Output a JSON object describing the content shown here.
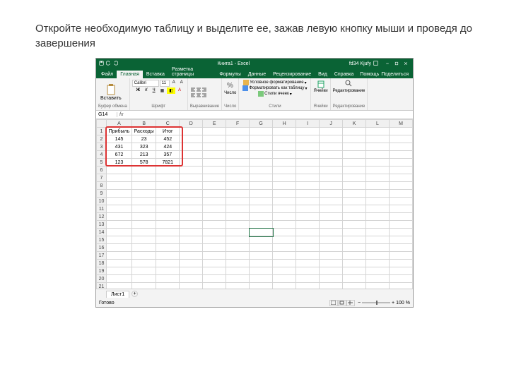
{
  "instruction": "Откройте необходимую таблицу и выделите ее, зажав левую кнопку мыши и проведя до завершения",
  "titlebar": {
    "doc": "Книга1 - Excel",
    "user": "fd34 Kjufy"
  },
  "tabs": {
    "file": "Файл",
    "items": [
      "Главная",
      "Вставка",
      "Разметка страницы",
      "Формулы",
      "Данные",
      "Рецензирование",
      "Вид",
      "Справка"
    ],
    "active": 0,
    "help": "Помощь",
    "share": "Поделиться"
  },
  "ribbon": {
    "paste": "Вставить",
    "clipboard": "Буфер обмена",
    "font_name": "Calibri",
    "font_size": "11",
    "font": "Шрифт",
    "align": "Выравнивание",
    "number": "Число",
    "cond": "Условное форматирование",
    "fmt_table": "Форматировать как таблицу",
    "cell_styles": "Стили ячеек",
    "styles": "Стили",
    "cells": "Ячейки",
    "editing": "Редактирование"
  },
  "namebox": "G14",
  "columns": [
    "A",
    "B",
    "C",
    "D",
    "E",
    "F",
    "G",
    "H",
    "I",
    "J",
    "K",
    "L",
    "M"
  ],
  "rows": 24,
  "table": {
    "headers": [
      "Прибыль",
      "Расходы",
      "Итог"
    ],
    "data": [
      [
        145,
        23,
        452
      ],
      [
        431,
        323,
        424
      ],
      [
        672,
        213,
        357
      ],
      [
        123,
        578,
        7821
      ]
    ]
  },
  "sheet_tab": "Лист1",
  "status": "Готово",
  "zoom": "100 %"
}
